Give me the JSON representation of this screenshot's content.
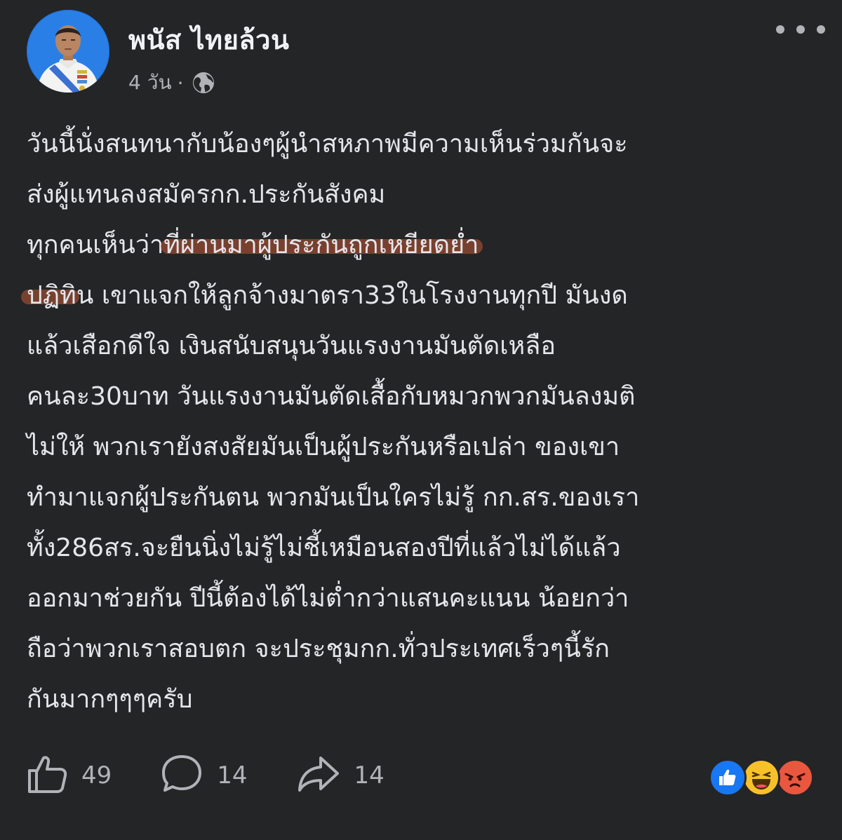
{
  "post": {
    "author_name": "พนัส ไทยล้วน",
    "timestamp": "4 วัน",
    "separator": "·",
    "privacy_icon": "globe-icon",
    "more_icon": "more-dots-icon",
    "lines": [
      {
        "text": "วันนี้นั่งสนทนากับน้องๆผู้นำสหภาพมีความเห็นร่วมกันจะ"
      },
      {
        "text": "ส่งผู้แทนลงสมัครกก.ประกันสังคม"
      },
      {
        "pre": "ทุกคนเห็นว่า",
        "highlight": "ที่ผ่านมาผู้ประกันถูกเหยียดย่ำ",
        "post": ""
      },
      {
        "pre": "",
        "highlight": "ปฏิทิ",
        "post": "น เขาแจกให้ลูกจ้างมาตรา33ในโรงงานทุกปี มันงด"
      },
      {
        "text": "แล้วเสือกดีใจ เงินสนับสนุนวันแรงงานมันตัดเหลือ"
      },
      {
        "text": "คนละ30บาท วันแรงงานมันตัดเสื้อกับหมวกพวกมันลงมติ"
      },
      {
        "text": "ไม่ให้ พวกเรายังสงสัยมันเป็นผู้ประกันหรือเปล่า ของเขา"
      },
      {
        "text": "ทำมาแจกผู้ประกันตน พวกมันเป็นใครไม่รู้ กก.สร.ของเรา"
      },
      {
        "text": "ทั้ง286สร.จะยืนนิ่งไม่รู้ไม่ชี้เหมือนสองปีที่แล้วไม่ได้แล้ว"
      },
      {
        "text": "ออกมาช่วยกัน ปีนี้ต้องได้ไม่ต่ำกว่าแสนคะแนน น้อยกว่า"
      },
      {
        "text": "ถือว่าพวกเราสอบตก จะประชุมกก.ทั่วประเทศเร็วๆนี้รัก"
      },
      {
        "text": "กันมากๆๆๆครับ"
      }
    ],
    "highlight_color": "#be5a37"
  },
  "actions": {
    "like": {
      "icon": "thumbs-up-icon",
      "count": "49"
    },
    "comment": {
      "icon": "comment-bubble-icon",
      "count": "14"
    },
    "share": {
      "icon": "share-arrow-icon",
      "count": "14"
    }
  },
  "reactions": [
    {
      "name": "like-reaction-icon",
      "color": "#1877f2"
    },
    {
      "name": "haha-reaction-icon",
      "color": "#f7b125"
    },
    {
      "name": "angry-reaction-icon",
      "color": "#e9573f"
    }
  ],
  "theme": {
    "background": "#242526",
    "text_primary": "#e4e6eb",
    "text_secondary": "#b0b3b8"
  }
}
